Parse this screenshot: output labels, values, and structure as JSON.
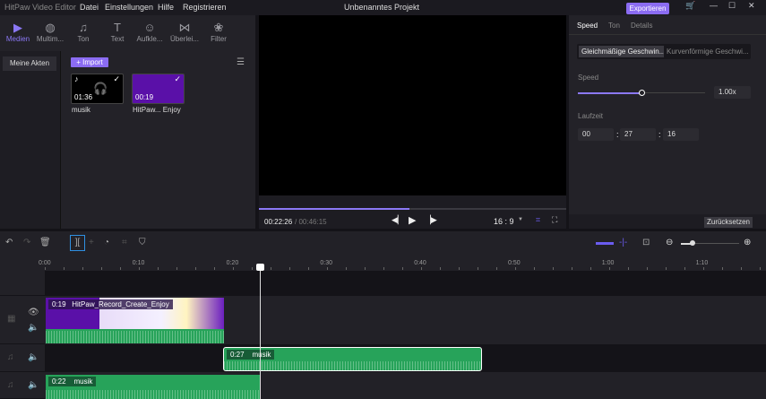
{
  "app": {
    "title": "HitPaw Video Editor",
    "project": "Unbenanntes Projekt",
    "export": "Exportieren"
  },
  "menu": [
    "Datei",
    "Einstellungen",
    "Hilfe",
    "Registrieren"
  ],
  "tabs": [
    {
      "label": "Medien",
      "icon": "▶"
    },
    {
      "label": "Multim...",
      "icon": "◍"
    },
    {
      "label": "Ton",
      "icon": "♫"
    },
    {
      "label": "Text",
      "icon": "T"
    },
    {
      "label": "Aufkle...",
      "icon": "☺"
    },
    {
      "label": "Überlei...",
      "icon": "⋈"
    },
    {
      "label": "Filter",
      "icon": "❀"
    }
  ],
  "media": {
    "my_files": "Meine Akten",
    "import": "+ Import",
    "items": [
      {
        "name": "musik",
        "duration": "01:36"
      },
      {
        "name": "HitPaw... Enjoy",
        "duration": "00:19"
      }
    ]
  },
  "player": {
    "current": "00:22:26",
    "total": "/ 00:46:15",
    "ratio": "16 : 9",
    "progress": 0.49
  },
  "right": {
    "tabs": [
      "Speed",
      "Ton",
      "Details"
    ],
    "modes": [
      "Gleichmäßige Geschwin...",
      "Kurvenförmige Geschwi..."
    ],
    "speed_label": "Speed",
    "speed": "1.00x",
    "speed_fraction": 0.5,
    "duration_label": "Laufzeit",
    "duration": [
      "00",
      "27",
      "16"
    ],
    "reset": "Zurücksetzen"
  },
  "timeline": {
    "ruler": [
      "0:00",
      "0:10",
      "0:20",
      "0:30",
      "0:40",
      "0:50",
      "1:00",
      "1:10"
    ],
    "clips": [
      {
        "duration": "0:19",
        "title": "HitPaw_Record_Create_Enjoy"
      },
      {
        "duration": "0:27",
        "title": "musik"
      },
      {
        "duration": "0:22",
        "title": "musik"
      }
    ]
  }
}
